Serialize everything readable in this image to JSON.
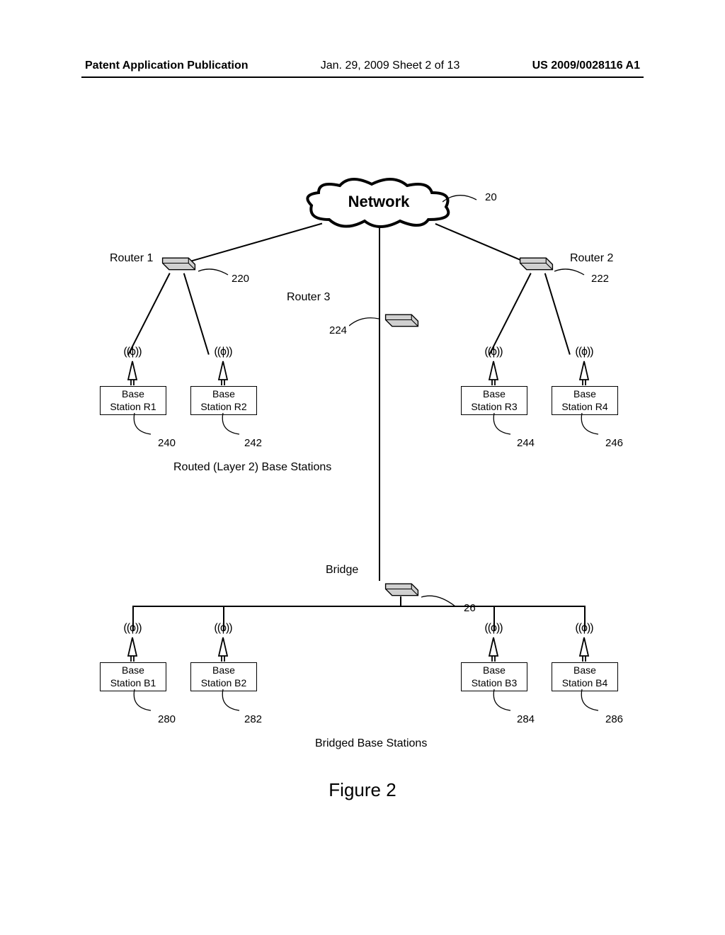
{
  "header": {
    "left": "Patent Application Publication",
    "center": "Jan. 29, 2009  Sheet 2 of 13",
    "right": "US 2009/0028116 A1"
  },
  "diagram": {
    "network_label": "Network",
    "network_ref": "20",
    "router1": {
      "label": "Router 1",
      "ref": "220"
    },
    "router2": {
      "label": "Router 2",
      "ref": "222"
    },
    "router3": {
      "label": "Router 3",
      "ref": "224"
    },
    "bridge": {
      "label": "Bridge",
      "ref": "26"
    },
    "routed_caption": "Routed (Layer 2) Base Stations",
    "bridged_caption": "Bridged Base Stations",
    "bs_r1": {
      "label1": "Base",
      "label2": "Station R1",
      "ref": "240"
    },
    "bs_r2": {
      "label1": "Base",
      "label2": "Station R2",
      "ref": "242"
    },
    "bs_r3": {
      "label1": "Base",
      "label2": "Station R3",
      "ref": "244"
    },
    "bs_r4": {
      "label1": "Base",
      "label2": "Station R4",
      "ref": "246"
    },
    "bs_b1": {
      "label1": "Base",
      "label2": "Station B1",
      "ref": "280"
    },
    "bs_b2": {
      "label1": "Base",
      "label2": "Station B2",
      "ref": "282"
    },
    "bs_b3": {
      "label1": "Base",
      "label2": "Station B3",
      "ref": "284"
    },
    "bs_b4": {
      "label1": "Base",
      "label2": "Station B4",
      "ref": "286"
    }
  },
  "figure_caption": "Figure 2"
}
